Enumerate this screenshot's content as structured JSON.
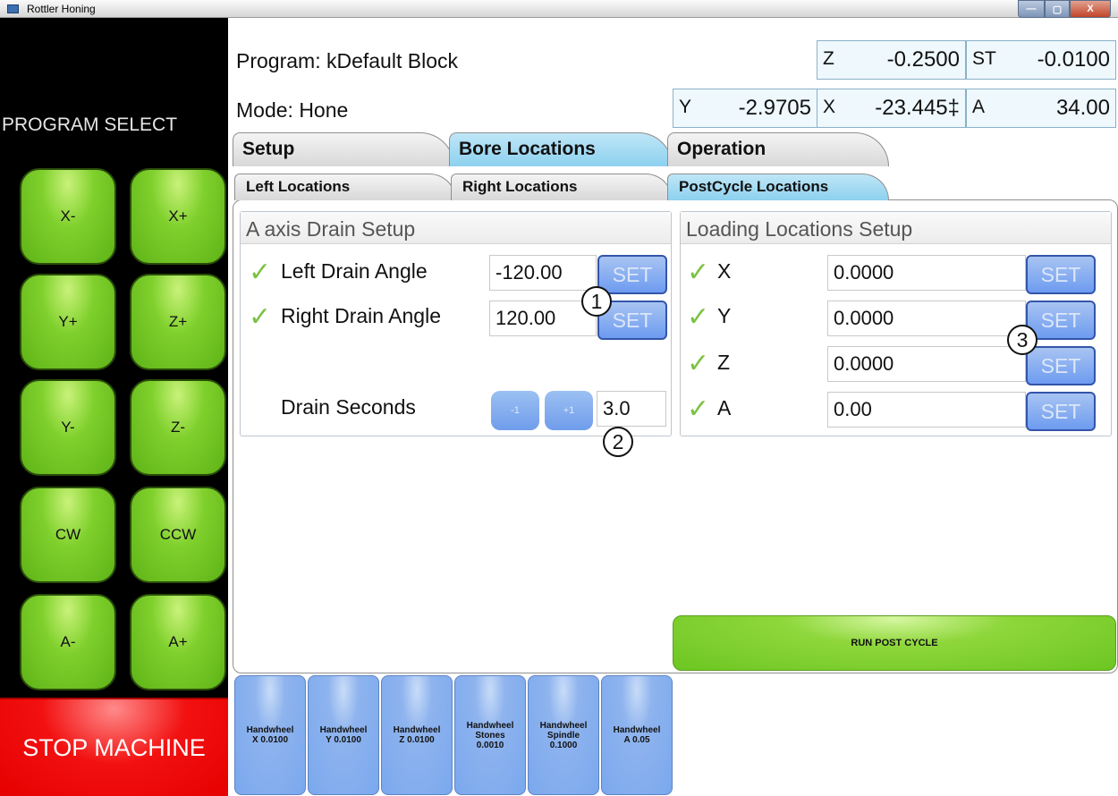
{
  "window": {
    "title": "Rottler Honing",
    "min_glyph": "—",
    "max_glyph": "▢",
    "close_glyph": "X"
  },
  "left_panel": {
    "program_select_label": "PROGRAM SELECT",
    "jog_buttons": [
      {
        "label": "X-"
      },
      {
        "label": "X+"
      },
      {
        "label": "Y+"
      },
      {
        "label": "Z+"
      },
      {
        "label": "Y-"
      },
      {
        "label": "Z-"
      },
      {
        "label": "CW"
      },
      {
        "label": "CCW"
      },
      {
        "label": "A-"
      },
      {
        "label": "A+"
      }
    ],
    "stop_label": "STOP MACHINE"
  },
  "header": {
    "program": "Program: kDefault Block",
    "mode": "Mode: Hone",
    "readouts": {
      "z": {
        "label": "Z",
        "value": "-0.2500"
      },
      "st": {
        "label": "ST",
        "value": "-0.0100"
      },
      "y": {
        "label": "Y",
        "value": "-2.9705"
      },
      "x": {
        "label": "X",
        "value": "-23.445‡"
      },
      "a": {
        "label": "A",
        "value": "34.00"
      }
    }
  },
  "tabs": {
    "main": [
      {
        "label": "Setup",
        "active": false
      },
      {
        "label": "Bore Locations",
        "active": true
      },
      {
        "label": "Operation",
        "active": false
      }
    ],
    "sub": [
      {
        "label": "Left Locations",
        "active": false
      },
      {
        "label": "Right Locations",
        "active": false
      },
      {
        "label": "PostCycle Locations",
        "active": true
      }
    ]
  },
  "drain": {
    "title": "A axis Drain Setup",
    "rows": [
      {
        "label": "Left Drain Angle",
        "value": "-120.00",
        "set": "SET"
      },
      {
        "label": "Right Drain Angle",
        "value": "120.00",
        "set": "SET"
      }
    ],
    "seconds_label": "Drain Seconds",
    "minus_label": "-1",
    "plus_label": "+1",
    "seconds_value": "3.0"
  },
  "loading": {
    "title": "Loading Locations Setup",
    "rows": [
      {
        "label": "X",
        "value": "0.0000",
        "set": "SET"
      },
      {
        "label": "Y",
        "value": "0.0000",
        "set": "SET"
      },
      {
        "label": "Z",
        "value": "0.0000",
        "set": "SET"
      },
      {
        "label": "A",
        "value": "0.00",
        "set": "SET"
      }
    ]
  },
  "callouts": [
    "1",
    "2",
    "3"
  ],
  "check_glyph": "✓",
  "run_post_cycle": "RUN POST CYCLE",
  "handwheels": [
    {
      "line1": "Handwheel",
      "line2": "X 0.0100",
      "line3": ""
    },
    {
      "line1": "Handwheel",
      "line2": "Y 0.0100",
      "line3": ""
    },
    {
      "line1": "Handwheel",
      "line2": "Z 0.0100",
      "line3": ""
    },
    {
      "line1": "Handwheel",
      "line2": "Stones",
      "line3": "0.0010"
    },
    {
      "line1": "Handwheel",
      "line2": "Spindle",
      "line3": "0.1000"
    },
    {
      "line1": "Handwheel",
      "line2": "A 0.05",
      "line3": ""
    }
  ]
}
